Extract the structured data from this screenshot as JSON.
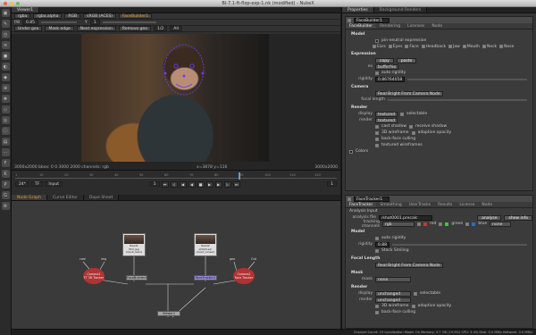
{
  "window": {
    "title": "Bl-7.1-ft-flop-exp-1.nk (modified) - NukeX"
  },
  "viewer": {
    "tabs": [
      "Viewer1"
    ],
    "controls": [
      "rgba",
      "rgba.alpha",
      "RGB",
      "sRGB (ACES)",
      "FaceBuilder1"
    ],
    "gain": "0.85",
    "gamma": "1",
    "row2": [
      "Under geo",
      "Mask edge",
      "Next expression",
      "Remove geo",
      "1/2",
      "All"
    ],
    "status_left": "3000x2000 bbox: 0 0 3000 2000 channels: rgb",
    "status_mid": "x=3878 y=116",
    "status_right": "3000x2000"
  },
  "timeline": {
    "ticks": [
      "1",
      "10",
      "20",
      "30",
      "40",
      "50",
      "60",
      "70",
      "80",
      "90",
      "100",
      "110",
      "120"
    ],
    "fps": "24*",
    "tc": "TF",
    "input": "Input",
    "frame": "1",
    "end": "1"
  },
  "dag": {
    "tabs": [
      "Node Graph",
      "Curve Editor",
      "Dope Sheet"
    ],
    "nodes": {
      "read1": [
        "Read1",
        "film.jpg",
        "(input_Gain)"
      ],
      "read2": [
        "Read2",
        "sh020.exr",
        "(input_Linear)"
      ],
      "camera1": [
        "Camera1",
        "FT 3D Tracker"
      ],
      "camera2": [
        "Camera2",
        "Face Tracker"
      ],
      "facebuilder": "FaceBuilder1",
      "facetracker": "FaceTracker1",
      "viewer": "Viewer1",
      "lbl_cam": "cam",
      "lbl_img": "img",
      "lbl_geo": "geo",
      "lbl_out": "Out"
    }
  },
  "props": {
    "tabs": [
      "Properties",
      "Background Renders"
    ],
    "fb": {
      "name": "FaceBuilder1",
      "tabs": [
        "FaceBuilder",
        "Rendering",
        "Licenses",
        "Node"
      ],
      "model_header": "Model",
      "model_opt": "pin-neutral expression",
      "parts": [
        "Ears",
        "Eyes",
        "Face",
        "Headback",
        "Jaw",
        "Mouth",
        "Neck",
        "Nose"
      ],
      "expr_header": "Expression",
      "copy": "copy",
      "paste": "paste",
      "expr_dd": "buffer%s",
      "rigidity": "auto rigidity",
      "rig_val": "0.86764058",
      "camera_header": "Camera",
      "camera_dd": "Real Bright From Camera Node",
      "focal": "focal length",
      "render_header": "Render",
      "display_lbl": "display",
      "display_dd": "textured",
      "selectable": "selectable",
      "render_lbl": "render",
      "render_dd": "textured",
      "cast": "cast shadow",
      "receive": "receive shadow",
      "wire1": "3D wireframe",
      "adaptive": "adaptive opacity",
      "backface": "back-face culling",
      "texwire": "textured wireframes",
      "colors": "Colors"
    },
    "ft": {
      "name": "FaceTracker1",
      "tabs": [
        "FaceTracker",
        "Smoothing",
        "UserTracks",
        "Results",
        "License",
        "Node"
      ],
      "analysis_input": "Analysis Input",
      "analysis_file": "analysis file",
      "file_val": "/shot0001.precalc",
      "analyse": "analyse",
      "show_info": "show info",
      "tracking_channels": "tracking channels",
      "ch_rgb": "rgb",
      "red": "red",
      "green": "green",
      "blue": "blue",
      "ch_none": "none",
      "model_header": "Model",
      "auto_rig": "auto rigidity",
      "rigidity": "rigidity",
      "rig_val": "0.88",
      "stack": "Stack Smiling",
      "focal_header": "Focal Length",
      "focal_dd": "Real Bright From Camera Node",
      "mask_header": "Mask",
      "mask_lbl": "mask",
      "mask_dd": "none",
      "render_header": "Render",
      "display_lbl": "display",
      "display_dd": "unchanged",
      "selectable": "selectable",
      "render_lbl": "render",
      "render_dd": "unchanged",
      "wire": "3D wireframe",
      "adaptive": "adaptive opacity",
      "backface": "back-face culling"
    }
  },
  "statusbar": "Channel Count: 19  Localization Mode: On  Memory: 3.7 GB (19.9%)  CPU: 3.4%  Disk: 0.0 MB/s  Network: 0.0 MB/s",
  "colors": {
    "accent": "#e89a3c",
    "camera": "#b23232",
    "mesh": "#6a3cff"
  }
}
